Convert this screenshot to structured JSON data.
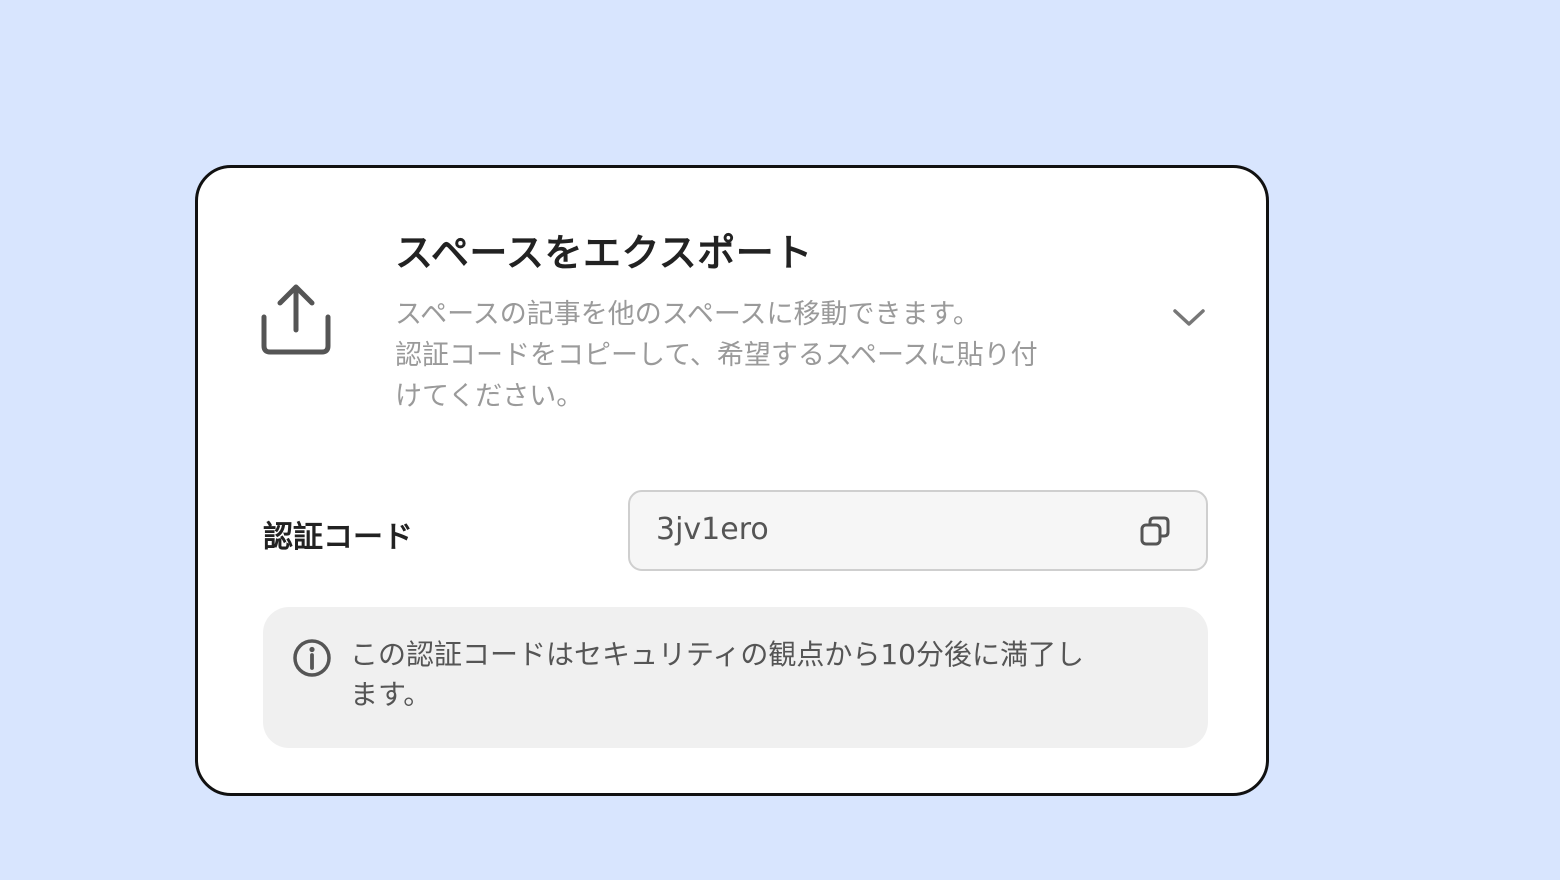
{
  "panel": {
    "title": "スペースをエクスポート",
    "description_lines": [
      "スペースの記事を他のスペースに移動できます。",
      "認証コードをコピーして、希望するスペースに貼り付",
      "けてください。"
    ],
    "icons": {
      "export": "upload-share-icon",
      "expand": "chevron-down-icon"
    }
  },
  "auth_code": {
    "label": "認証コード",
    "value": "3jv1ero",
    "copy_icon": "copy-icon"
  },
  "notice": {
    "icon": "info-icon",
    "lines": [
      "この認証コードはセキュリティの観点から10分後に満了し",
      "ます。"
    ]
  },
  "colors": {
    "background": "#d8e5fe",
    "card": "#ffffff",
    "card_border": "#111111",
    "muted_text": "#9a9a9a",
    "notice_bg": "#f0f0f0",
    "field_bg": "#f6f6f6"
  }
}
